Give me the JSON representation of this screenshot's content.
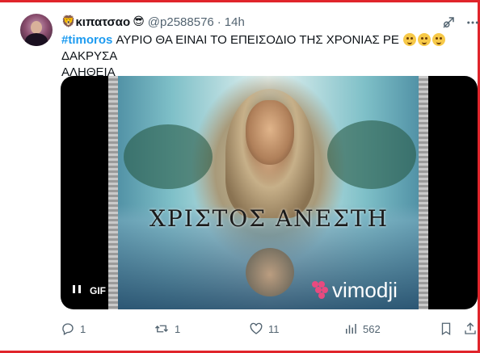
{
  "tweet": {
    "display_name": "κιπατσαο",
    "name_emoji_lead": "🦁",
    "name_emoji_trail": "😎",
    "handle": "@p2588576",
    "separator": "·",
    "time": "14h",
    "hashtag": "#timoros",
    "text_main": " ΑΥΡΙΟ ΘΑ ΕΙΝΑΙ ΤΟ ΕΠΕΙΣΟΔΙΟ ΤΗΣ ΧΡΟΝΙΑΣ ΡΕ ",
    "text_after": "ΔΑΚΡΥΣΑ",
    "text_line2": "ΑΛΗΘΕΙΑ"
  },
  "media": {
    "caption": "ΧΡΙΣΤΟΣ ΑΝΕΣΤΗ",
    "watermark": "vimodji",
    "gif_label": "GIF"
  },
  "actions": {
    "replies": "1",
    "reposts": "1",
    "likes": "11",
    "views": "562"
  },
  "colors": {
    "accent": "#1d9bf0",
    "secondary_text": "#536471",
    "frame": "#e0242b"
  }
}
